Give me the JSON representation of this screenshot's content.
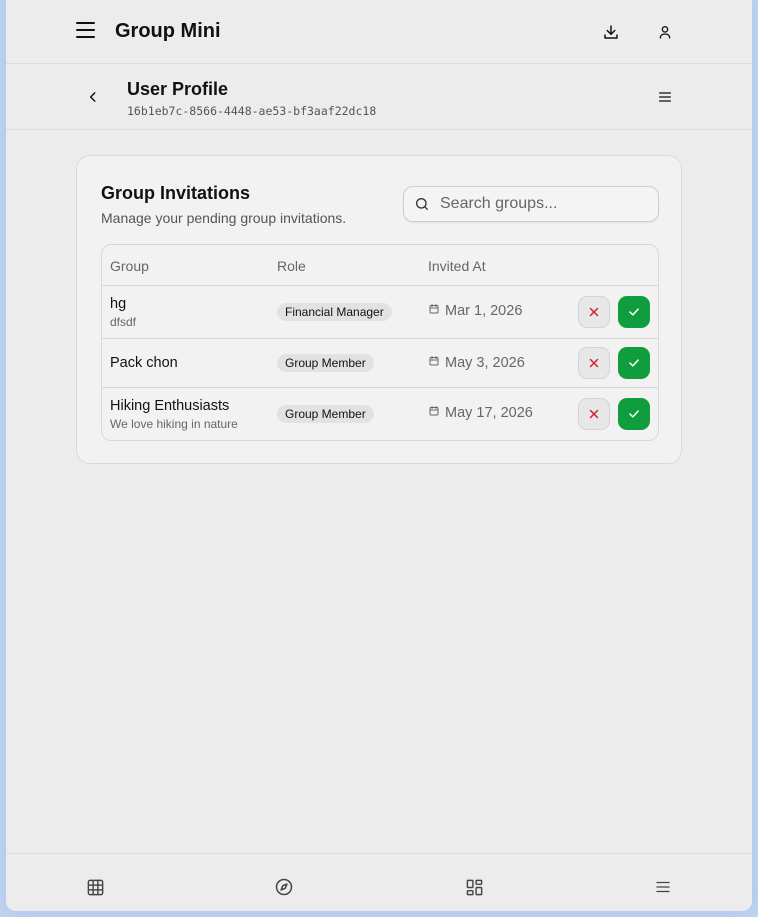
{
  "app": {
    "title": "Group Mini"
  },
  "subheader": {
    "title": "User Profile",
    "id": "16b1eb7c-8566-4448-ae53-bf3aaf22dc18"
  },
  "card": {
    "title": "Group Invitations",
    "description": "Manage your pending group invitations.",
    "search_placeholder": "Search groups..."
  },
  "table": {
    "headers": [
      "Group",
      "Role",
      "Invited At"
    ],
    "rows": [
      {
        "name": "hg",
        "description": "dfsdf",
        "role": "Financial Manager",
        "invited_at": "Mar 1, 2026"
      },
      {
        "name": "Pack chon",
        "description": "",
        "role": "Group Member",
        "invited_at": "May 3, 2026"
      },
      {
        "name": "Hiking Enthusiasts",
        "description": "We love hiking in nature",
        "role": "Group Member",
        "invited_at": "May 17, 2026"
      }
    ]
  },
  "icons": {
    "menu": "hamburger-icon",
    "download": "download-icon",
    "user": "user-icon",
    "back": "chevron-left-icon",
    "list": "list-icon",
    "search": "search-icon",
    "calendar": "calendar-icon",
    "reject": "close-icon",
    "accept": "check-icon",
    "nav": [
      "grid-icon",
      "compass-icon",
      "dashboard-icon",
      "menu-icon"
    ]
  },
  "colors": {
    "accept": "#0f9d3e",
    "reject": "#d0202a",
    "background": "#ececec"
  }
}
